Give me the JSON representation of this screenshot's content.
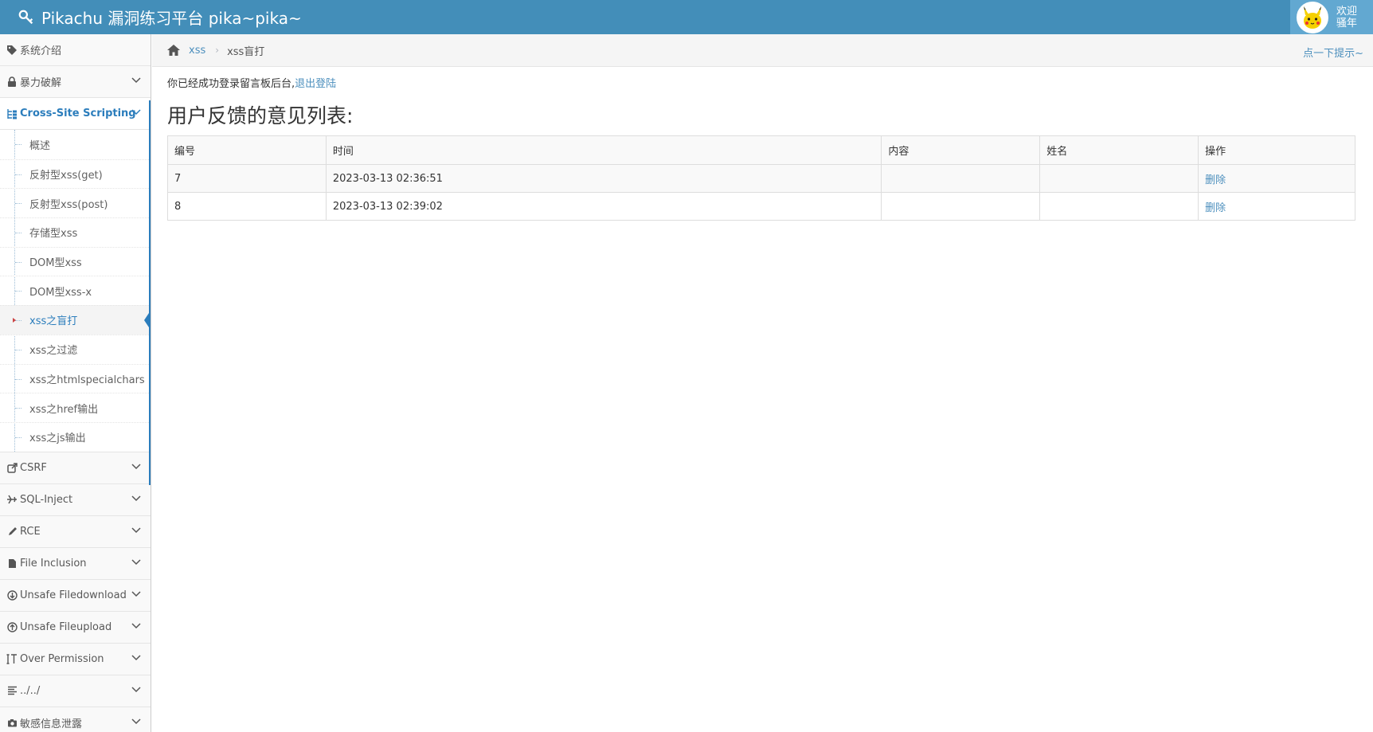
{
  "header": {
    "brand_title": "Pikachu 漏洞练习平台 pika~pika~",
    "welcome_line1": "欢迎",
    "welcome_line2": "骚年",
    "accent_color": "#438eb9"
  },
  "sidebar": {
    "items_top": [
      {
        "label": "系统介绍",
        "icon": "tags-icon"
      },
      {
        "label": "暴力破解",
        "icon": "lock-icon"
      },
      {
        "label": "Cross-Site Scripting",
        "icon": "tree-icon"
      }
    ],
    "xss_subitems": [
      {
        "label": "概述"
      },
      {
        "label": "反射型xss(get)"
      },
      {
        "label": "反射型xss(post)"
      },
      {
        "label": "存储型xss"
      },
      {
        "label": "DOM型xss"
      },
      {
        "label": "DOM型xss-x"
      },
      {
        "label": "xss之盲打"
      },
      {
        "label": "xss之过滤"
      },
      {
        "label": "xss之htmlspecialchars"
      },
      {
        "label": "xss之href输出"
      },
      {
        "label": "xss之js输出"
      }
    ],
    "items_bottom": [
      {
        "label": "CSRF",
        "icon": "share-icon"
      },
      {
        "label": "SQL-Inject",
        "icon": "plane-icon"
      },
      {
        "label": "RCE",
        "icon": "pencil-icon"
      },
      {
        "label": "File Inclusion",
        "icon": "file-icon"
      },
      {
        "label": "Unsafe Filedownload",
        "icon": "download-icon"
      },
      {
        "label": "Unsafe Fileupload",
        "icon": "upload-icon"
      },
      {
        "label": "Over Permission",
        "icon": "text-height-icon"
      },
      {
        "label": "../../",
        "icon": "align-left-icon"
      },
      {
        "label": "敏感信息泄露",
        "icon": "camera-icon"
      }
    ]
  },
  "breadcrumb": {
    "link": "xss",
    "current": "xss盲打",
    "hint": "点一下提示~"
  },
  "content": {
    "login_msg": "你已经成功登录留言板后台,",
    "logout_link": "退出登陆",
    "list_title": "用户反馈的意见列表:",
    "table": {
      "headers": [
        "编号",
        "时间",
        "内容",
        "姓名",
        "操作"
      ],
      "rows": [
        {
          "id": "7",
          "time": "2023-03-13 02:36:51",
          "content": "",
          "name": "",
          "action": "删除"
        },
        {
          "id": "8",
          "time": "2023-03-13 02:39:02",
          "content": "",
          "name": "",
          "action": "删除"
        }
      ]
    }
  }
}
